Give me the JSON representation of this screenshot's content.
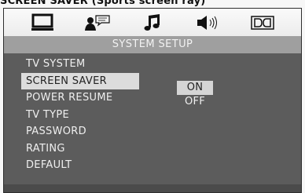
{
  "caption": "SCREEN SAVER (Sports screen ray)",
  "icons": [
    "monitor-icon",
    "user-speech-icon",
    "music-note-icon",
    "speaker-volume-icon",
    "dolby-digital-icon"
  ],
  "title": "SYSTEM SETUP",
  "menu": {
    "items": [
      {
        "label": "TV SYSTEM"
      },
      {
        "label": "SCREEN SAVER"
      },
      {
        "label": "POWER RESUME"
      },
      {
        "label": "TV TYPE"
      },
      {
        "label": "PASSWORD"
      },
      {
        "label": "RATING"
      },
      {
        "label": "DEFAULT"
      }
    ],
    "selected": "SCREEN SAVER"
  },
  "submenu": {
    "options": [
      {
        "label": "ON"
      },
      {
        "label": "OFF"
      }
    ],
    "selected": "ON"
  },
  "colors": {
    "background": "#5c5c5c",
    "titlebar": "#9f9f9f",
    "highlight": "#dcdcdc"
  }
}
